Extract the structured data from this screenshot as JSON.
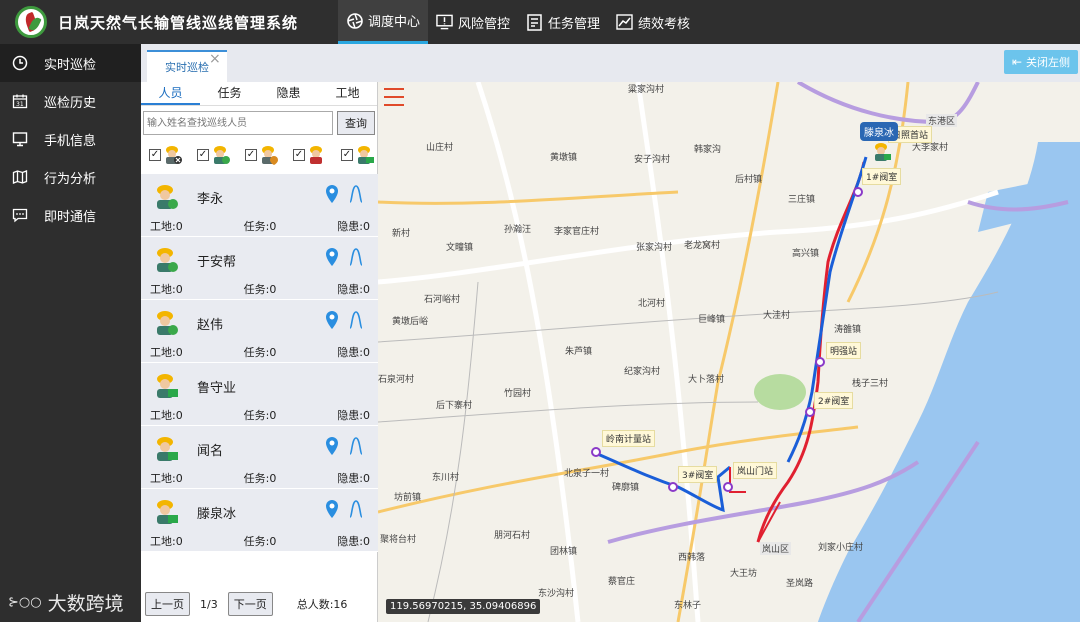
{
  "app": {
    "title": "日岚天然气长输管线巡线管理系统"
  },
  "nav": {
    "items": [
      {
        "label": "调度中心",
        "active": true
      },
      {
        "label": "风险管控"
      },
      {
        "label": "任务管理"
      },
      {
        "label": "绩效考核"
      }
    ]
  },
  "sidebar": {
    "items": [
      {
        "label": "实时巡检",
        "active": true
      },
      {
        "label": "巡检历史"
      },
      {
        "label": "手机信息"
      },
      {
        "label": "行为分析"
      },
      {
        "label": "即时通信"
      }
    ],
    "watermark": "大数跨境"
  },
  "tabs": {
    "current": "实时巡检",
    "close_left": "关闭左侧"
  },
  "panel": {
    "tabs": [
      "人员",
      "任务",
      "隐患",
      "工地"
    ],
    "search": {
      "placeholder": "输入姓名查找巡线人员",
      "button": "查询"
    },
    "persons": [
      {
        "name": "李永",
        "site": "工地:0",
        "task": "任务:0",
        "hazard": "隐患:0",
        "has_location": true
      },
      {
        "name": "于安帮",
        "site": "工地:0",
        "task": "任务:0",
        "hazard": "隐患:0",
        "has_location": true
      },
      {
        "name": "赵伟",
        "site": "工地:0",
        "task": "任务:0",
        "hazard": "隐患:0",
        "has_location": true
      },
      {
        "name": "鲁守业",
        "site": "工地:0",
        "task": "任务:0",
        "hazard": "隐患:0",
        "has_location": false
      },
      {
        "name": "闻名",
        "site": "工地:0",
        "task": "任务:0",
        "hazard": "隐患:0",
        "has_location": true
      },
      {
        "name": "滕泉冰",
        "site": "工地:0",
        "task": "任务:0",
        "hazard": "隐患:0",
        "has_location": true
      }
    ],
    "pager": {
      "prev": "上一页",
      "page": "1/3",
      "next": "下一页",
      "total": "总人数:16"
    }
  },
  "map": {
    "coord": "119.56970215, 35.09406896",
    "marker": "滕泉冰",
    "places": [
      "粱家沟村",
      "山庄村",
      "黄墩镇",
      "安子沟村",
      "韩家沟",
      "后村镇",
      "三庄镇",
      "新村",
      "孙瀚汪",
      "李家官庄村",
      "文疃镇",
      "张家沟村",
      "老龙窝村",
      "高兴镇",
      "石河峪村",
      "北河村",
      "巨峰镇",
      "大洼村",
      "涛雒镇",
      "黄墩后峪",
      "朱芦镇",
      "纪家沟村",
      "大卜落村",
      "栈子三村",
      "石泉河村",
      "竹园村",
      "后下寨村",
      "东川村",
      "北泉子一村",
      "碑廓镇",
      "坊前镇",
      "聚将台村",
      "朋河石村",
      "团林镇",
      "西韩落",
      "东沙沟村",
      "蔡官庄",
      "大王坊",
      "圣岚路",
      "东林子",
      "刘家小庄村",
      "大李家村",
      "东港区",
      "岚山区"
    ],
    "stations": [
      "日照首站",
      "1#阀室",
      "明强站",
      "2#阀室",
      "岚山门站",
      "3#阀室",
      "岭南计量站"
    ]
  }
}
